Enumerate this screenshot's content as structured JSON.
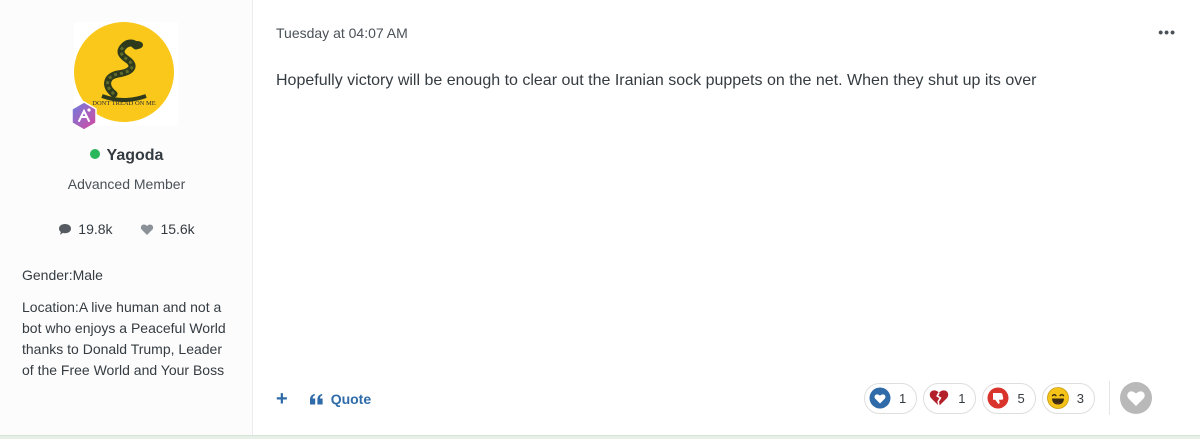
{
  "author": {
    "name": "Yagoda",
    "title": "Advanced Member",
    "avatar_text": "DONT TREAD ON ME",
    "stats": {
      "posts": "19.8k",
      "reputation": "15.6k"
    },
    "fields": {
      "gender": "Gender:Male",
      "location": "Location:A live human and not a bot who enjoys a Peaceful World thanks to Donald Trump, Leader of the Free World and Your Boss"
    }
  },
  "post": {
    "date": "Tuesday at 04:07 AM",
    "menu_label": "•••",
    "body": "Hopefully victory will be enough to clear out the Iranian sock puppets on the net. When they shut up its over"
  },
  "actions": {
    "add_label": "+",
    "quote_label": "Quote"
  },
  "reactions": [
    {
      "icon": "like-heart-icon",
      "count": "1"
    },
    {
      "icon": "broken-heart-icon",
      "count": "1"
    },
    {
      "icon": "thumbs-down-icon",
      "count": "5"
    },
    {
      "icon": "laughing-face-icon",
      "count": "3"
    }
  ],
  "colors": {
    "accent": "#2e6ba8",
    "online": "#2ab65a",
    "like": "#2e6ba8",
    "broken_heart": "#b3202a",
    "thumbs_down": "#d9342b",
    "laugh": "#f5c318"
  }
}
